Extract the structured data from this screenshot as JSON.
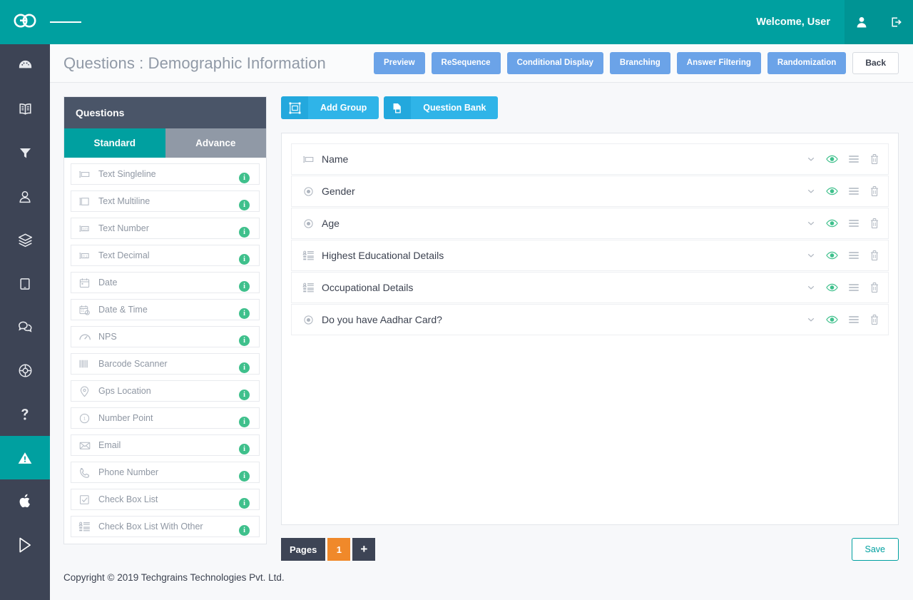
{
  "topbar": {
    "logo_icon": "go-logo-icon",
    "menu_icon": "hamburger-menu-icon",
    "welcome_text": "Welcome, User",
    "user_icon": "user-icon",
    "logout_icon": "logout-icon",
    "bg_color": "#00a0a0"
  },
  "rail": {
    "bg_color": "#3d4455",
    "active_color": "#00a0a0",
    "items": [
      {
        "icon": "dashboard-speedometer-icon",
        "active": false
      },
      {
        "icon": "book-icon",
        "active": false
      },
      {
        "icon": "filter-icon",
        "active": false
      },
      {
        "icon": "user-icon",
        "active": false
      },
      {
        "icon": "layers-icon",
        "active": false
      },
      {
        "icon": "tablet-icon",
        "active": false
      },
      {
        "icon": "chat-bubbles-icon",
        "active": false
      },
      {
        "icon": "lifebuoy-icon",
        "active": false
      },
      {
        "icon": "question-mark-icon",
        "active": false
      },
      {
        "icon": "warning-triangle-icon",
        "active": true
      },
      {
        "icon": "apple-icon",
        "active": false
      },
      {
        "icon": "play-store-icon",
        "active": false
      }
    ]
  },
  "header": {
    "title": "Questions : Demographic Information",
    "buttons": [
      {
        "label": "Preview",
        "style": "blue"
      },
      {
        "label": "ReSequence",
        "style": "blue"
      },
      {
        "label": "Conditional Display",
        "style": "blue"
      },
      {
        "label": "Branching",
        "style": "blue"
      },
      {
        "label": "Answer Filtering",
        "style": "blue"
      },
      {
        "label": "Randomization",
        "style": "blue"
      }
    ],
    "back_label": "Back",
    "blue_color": "#6ba3e8"
  },
  "questions_panel": {
    "title": "Questions",
    "tabs": [
      {
        "label": "Standard",
        "active": true
      },
      {
        "label": "Advance",
        "active": false
      }
    ],
    "active_tab_color": "#00a0a0",
    "inactive_tab_color": "#9099a6",
    "info_badge_char": "i",
    "info_badge_color": "#3fc08c",
    "types": [
      {
        "label": "Text Singleline",
        "icon": "text-singleline-icon"
      },
      {
        "label": "Text Multiline",
        "icon": "text-multiline-icon"
      },
      {
        "label": "Text Number",
        "icon": "text-number-icon"
      },
      {
        "label": "Text Decimal",
        "icon": "text-decimal-icon"
      },
      {
        "label": "Date",
        "icon": "calendar-icon"
      },
      {
        "label": "Date & Time",
        "icon": "calendar-clock-icon"
      },
      {
        "label": "NPS",
        "icon": "nps-gauge-icon"
      },
      {
        "label": "Barcode Scanner",
        "icon": "barcode-icon"
      },
      {
        "label": "Gps Location",
        "icon": "map-pin-icon"
      },
      {
        "label": "Number Point",
        "icon": "clock-number-icon"
      },
      {
        "label": "Email",
        "icon": "envelope-icon"
      },
      {
        "label": "Phone Number",
        "icon": "phone-icon"
      },
      {
        "label": "Check Box List",
        "icon": "checkbox-icon"
      },
      {
        "label": "Check Box List With Other",
        "icon": "checkbox-list-other-icon"
      }
    ]
  },
  "toolbar": {
    "add_group_label": "Add Group",
    "add_group_icon": "add-group-icon",
    "question_bank_label": "Question Bank",
    "question_bank_icon": "question-bank-icon",
    "color": "#2fb4e8"
  },
  "questions": {
    "rows": [
      {
        "label": "Name",
        "icon": "text-singleline-icon"
      },
      {
        "label": "Gender",
        "icon": "radio-button-icon"
      },
      {
        "label": "Age",
        "icon": "radio-button-icon"
      },
      {
        "label": "Highest Educational Details",
        "icon": "checkbox-list-other-icon"
      },
      {
        "label": "Occupational Details",
        "icon": "checkbox-list-other-icon"
      },
      {
        "label": "Do you have Aadhar Card?",
        "icon": "radio-button-icon"
      }
    ],
    "row_actions": [
      {
        "icon": "chevron-down-icon"
      },
      {
        "icon": "eye-icon"
      },
      {
        "icon": "reorder-icon"
      },
      {
        "icon": "trash-icon"
      }
    ]
  },
  "footer": {
    "pages_label": "Pages",
    "page_number": "1",
    "add_page_label": "+",
    "save_label": "Save",
    "page_number_color": "#f0892a",
    "save_color": "#00a0a0"
  },
  "copyright": "Copyright © 2019 Techgrains Technologies Pvt. Ltd."
}
